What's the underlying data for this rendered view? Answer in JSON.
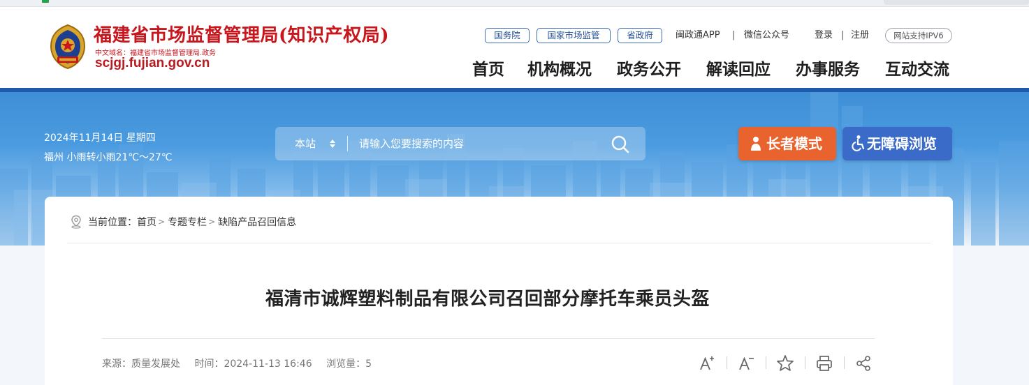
{
  "header": {
    "site_title": "福建省市场监督管理局(知识产权局)",
    "domain_cn": "中文域名：福建省市场监督管理局.政务",
    "domain": "scjgj.fujian.gov.cn",
    "top_links": {
      "guowuyuan": "国务院",
      "guojia": "国家市场监管",
      "shengzhengfu": "省政府",
      "mzt_app": "闽政通APP",
      "wechat": "微信公众号",
      "login": "登录",
      "register": "注册",
      "ipv6": "网站支持IPV6",
      "sep1": "|",
      "sep2": "|"
    },
    "nav": [
      "首页",
      "机构概况",
      "政务公开",
      "解读回应",
      "办事服务",
      "互动交流"
    ]
  },
  "banner": {
    "date": "2024年11月14日 星期四",
    "weather": "福州 小雨转小雨21℃～27℃",
    "search": {
      "scope": "本站",
      "placeholder": "请输入您要搜索的内容"
    },
    "elder_mode": "长者模式",
    "accessible": "无障碍浏览"
  },
  "breadcrumb": {
    "prefix": "当前位置：",
    "items": [
      "首页",
      "专题专栏",
      "缺陷产品召回信息"
    ],
    "separator": ">"
  },
  "article": {
    "title": "福清市诚辉塑料制品有限公司召回部分摩托车乘员头盔",
    "source": "来源：质量发展处",
    "time": "时间：2024-11-13 16:46",
    "views": "浏览量：5"
  },
  "icons": {
    "font_increase": "font-increase-icon",
    "font_decrease": "font-decrease-icon",
    "favorite": "star-icon",
    "print": "printer-icon",
    "share": "share-icon"
  },
  "colors": {
    "brand_red": "#c8161d",
    "brand_blue": "#1d5aab",
    "elder_orange": "#e8632e",
    "access_blue": "#3b6bc9"
  }
}
